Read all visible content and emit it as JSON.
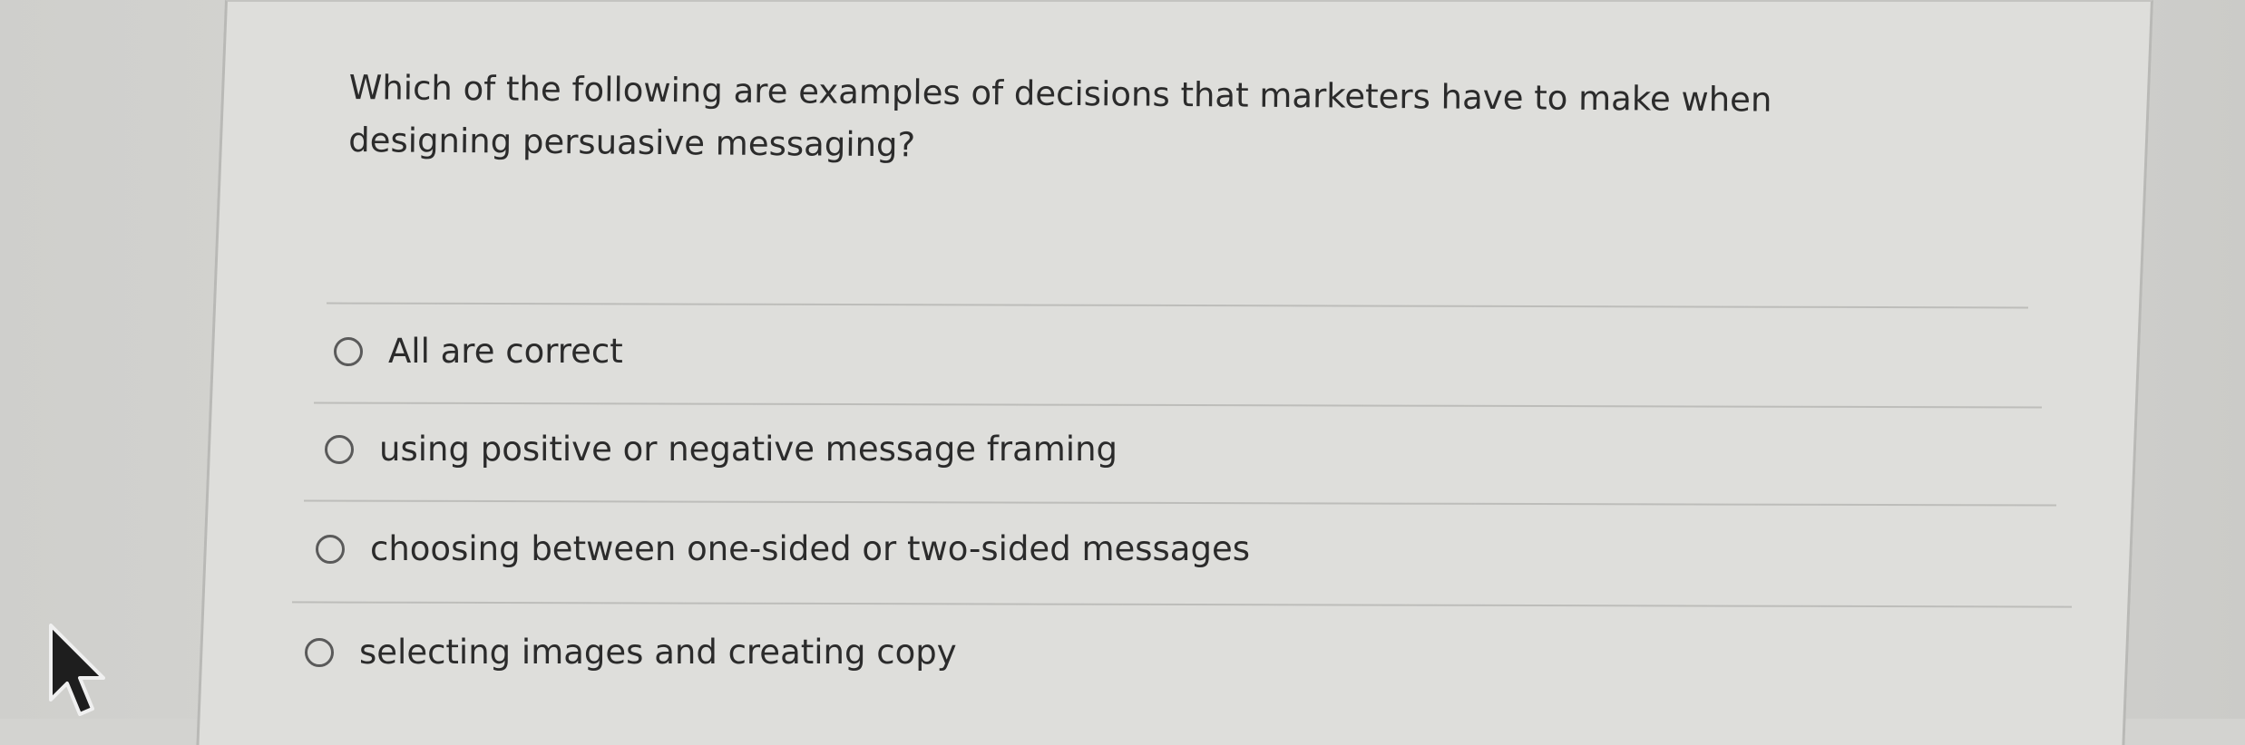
{
  "question": {
    "text": "Which of the following are examples of decisions that marketers have to make when designing persuasive messaging?"
  },
  "options": [
    {
      "label": "All are correct",
      "selected": false
    },
    {
      "label": "using positive or negative message framing",
      "selected": false
    },
    {
      "label": "choosing between one-sided or two-sided messages",
      "selected": false
    },
    {
      "label": "selecting images and creating copy",
      "selected": false
    }
  ],
  "icons": {
    "cursor": "mouse-pointer-icon",
    "radio": "radio-unchecked-icon"
  },
  "colors": {
    "background": "#d3d3d0",
    "card": "#dededb",
    "text": "#2b2b2b",
    "divider": "#bdbdba",
    "radio_border": "#5a5a5a"
  }
}
